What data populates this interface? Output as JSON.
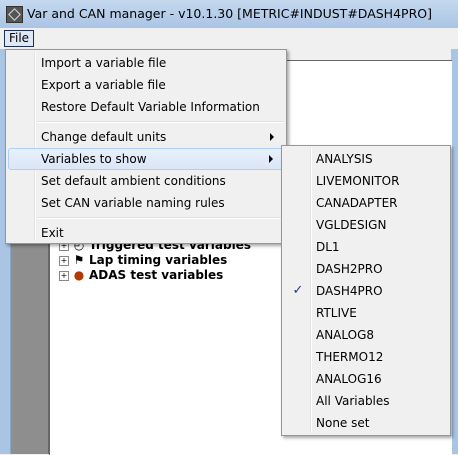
{
  "window": {
    "title": "Var and CAN manager - v10.1.30 [METRIC#INDUST#DASH4PRO]"
  },
  "menubar": {
    "file_label": "File"
  },
  "file_menu": {
    "items": [
      {
        "label": "Import a variable file"
      },
      {
        "label": "Export a variable file"
      },
      {
        "label": "Restore Default Variable Information"
      },
      {
        "label": "Change default units",
        "submenu": true
      },
      {
        "label": "Variables to show",
        "submenu": true,
        "highlighted": true
      },
      {
        "label": "Set default ambient conditions"
      },
      {
        "label": "Set CAN variable naming rules"
      },
      {
        "label": "Exit"
      }
    ]
  },
  "variables_submenu": {
    "items": [
      {
        "label": "ANALYSIS"
      },
      {
        "label": "LIVEMONITOR"
      },
      {
        "label": "CANADAPTER"
      },
      {
        "label": "VGLDESIGN"
      },
      {
        "label": "DL1"
      },
      {
        "label": "DASH2PRO"
      },
      {
        "label": "DASH4PRO",
        "checked": true
      },
      {
        "label": "RTLIVE"
      },
      {
        "label": "ANALOG8"
      },
      {
        "label": "THERMO12"
      },
      {
        "label": "ANALOG16"
      },
      {
        "label": "All Variables"
      },
      {
        "label": "None set"
      }
    ],
    "check_glyph": "✓"
  },
  "tree": {
    "items": [
      {
        "label": "Triggered test variables",
        "icon": "clock-icon"
      },
      {
        "label": "Lap timing variables",
        "icon": "flag-icon"
      },
      {
        "label": "ADAS test variables",
        "icon": "car-icon"
      }
    ]
  }
}
